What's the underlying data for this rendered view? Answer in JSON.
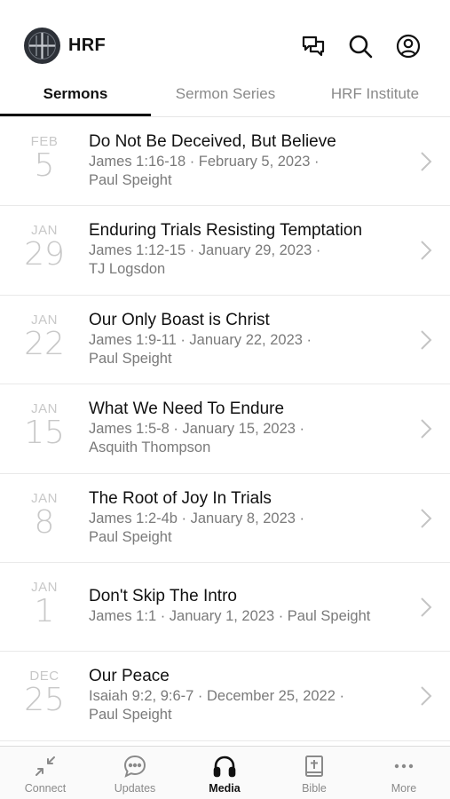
{
  "header": {
    "brand": "HRF",
    "icons": [
      "logo-icon",
      "chat-icon",
      "search-icon",
      "profile-icon"
    ]
  },
  "tabs": [
    {
      "label": "Sermons",
      "active": true
    },
    {
      "label": "Sermon Series",
      "active": false
    },
    {
      "label": "HRF Institute",
      "active": false
    }
  ],
  "sermons": [
    {
      "month": "FEB",
      "day": "5",
      "title": "Do Not Be Deceived, But Believe",
      "meta1": "James 1:16-18 · February 5, 2023 ·",
      "meta2": "Paul Speight"
    },
    {
      "month": "JAN",
      "day": "29",
      "title": "Enduring Trials Resisting Temptation",
      "meta1": "James 1:12-15 · January 29, 2023 ·",
      "meta2": "TJ Logsdon"
    },
    {
      "month": "JAN",
      "day": "22",
      "title": "Our Only Boast is Christ",
      "meta1": "James 1:9-11 · January 22, 2023 ·",
      "meta2": "Paul Speight"
    },
    {
      "month": "JAN",
      "day": "15",
      "title": "What We Need To Endure",
      "meta1": "James 1:5-8 · January 15, 2023 ·",
      "meta2": "Asquith Thompson"
    },
    {
      "month": "JAN",
      "day": "8",
      "title": "The Root of Joy In Trials",
      "meta1": "James 1:2-4b · January 8, 2023 ·",
      "meta2": "Paul Speight"
    },
    {
      "month": "JAN",
      "day": "1",
      "title": "Don't Skip The Intro",
      "meta1": "James 1:1 · January 1, 2023 · Paul Speight",
      "meta2": ""
    },
    {
      "month": "DEC",
      "day": "25",
      "title": "Our Peace",
      "meta1": "Isaiah 9:2, 9:6-7 · December 25, 2022 ·",
      "meta2": "Paul Speight"
    }
  ],
  "tabbar": [
    {
      "label": "Connect",
      "icon": "connect-icon",
      "active": false
    },
    {
      "label": "Updates",
      "icon": "updates-icon",
      "active": false
    },
    {
      "label": "Media",
      "icon": "headphones-icon",
      "active": true
    },
    {
      "label": "Bible",
      "icon": "bible-icon",
      "active": false
    },
    {
      "label": "More",
      "icon": "more-icon",
      "active": false
    }
  ],
  "colors": {
    "text": "#111111",
    "muted": "#7a7a7a",
    "date": "#c8c8c8",
    "logo_bg": "#2d3138"
  }
}
